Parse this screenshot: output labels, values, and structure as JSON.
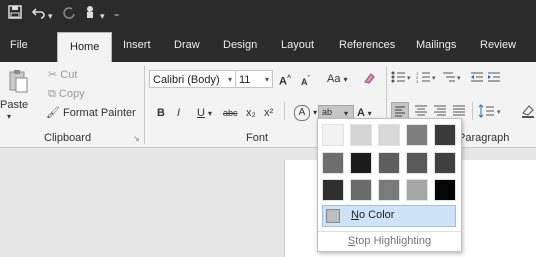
{
  "qat": {
    "save_icon": "save-icon",
    "undo_icon": "undo-icon",
    "redo_icon": "redo-icon",
    "touch_icon": "touch-mode-icon",
    "customize_icon": "customize-icon"
  },
  "tabs": [
    "File",
    "Home",
    "Insert",
    "Draw",
    "Design",
    "Layout",
    "References",
    "Mailings",
    "Review"
  ],
  "clipboard": {
    "cut": "Cut",
    "copy": "Copy",
    "paste": "Paste",
    "format_painter": "Format Painter",
    "group": "Clipboard"
  },
  "font": {
    "name": "Calibri (Body)",
    "size": "11",
    "grow": "A",
    "shrink": "A",
    "change_case": "Aa",
    "bold": "B",
    "italic": "I",
    "underline": "U",
    "strike": "abc",
    "sub": "x₂",
    "sup": "x²",
    "highlight": "ab",
    "font_color": "A",
    "group": "Font",
    "text_effects": "A"
  },
  "paragraph": {
    "group": "Paragraph"
  },
  "highlight_menu": {
    "colors": [
      "#f2f2f2",
      "#d4d4d4",
      "#d9d9d9",
      "#7f7f7f",
      "#3a3a3a",
      "#6e6e6e",
      "#1c1c1c",
      "#5e5e5e",
      "#595959",
      "#404040",
      "#2f2f2f",
      "#6b6b6b",
      "#7a7a7a",
      "#a6a6a6",
      "#050505"
    ],
    "no_color_prefix": "N",
    "no_color_rest": "o Color",
    "stop_prefix": "S",
    "stop_rest": "top Highlighting"
  }
}
